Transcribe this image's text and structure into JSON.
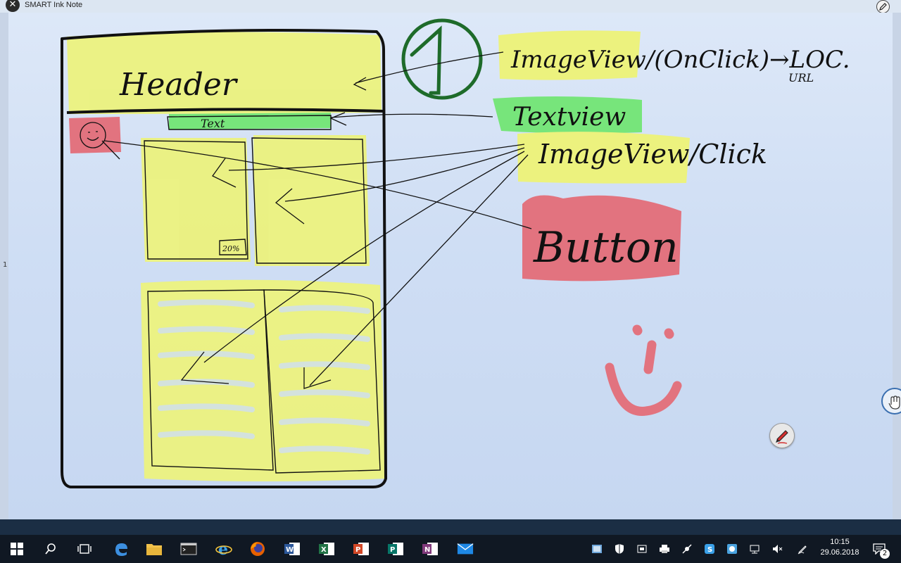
{
  "window": {
    "title": "SMART Ink Note",
    "close_glyph": "✕"
  },
  "margin": {
    "left_number": "1"
  },
  "sketch": {
    "header_label": "Header",
    "text_bar_label": "Text",
    "badge_label": "20%",
    "circled_number": "1",
    "note_imageview_onclick": "ImageView/(OnClick)→LOC.",
    "note_url": "URL",
    "note_textview": "Textview",
    "note_imageview_click": "ImageView/Click",
    "note_button": "Button",
    "colors": {
      "highlighter_yellow": "#ecf27e",
      "highlighter_green": "#77e57b",
      "highlighter_red": "#e2737f",
      "circle_green": "#1e6b2a",
      "ink": "#111111"
    }
  },
  "tools": {
    "hand": "hand-tool-icon",
    "pen": "pen-tool-icon"
  },
  "taskbar": {
    "apps": [
      "windows-start-icon",
      "search-icon",
      "task-view-icon",
      "edge-icon",
      "file-explorer-icon",
      "terminal-icon",
      "internet-explorer-icon",
      "firefox-icon",
      "word-icon",
      "excel-icon",
      "powerpoint-icon",
      "publisher-icon",
      "onenote-icon",
      "mail-icon"
    ],
    "clock_time": "10:15",
    "clock_date": "29.06.2018",
    "notification_count": "2"
  }
}
